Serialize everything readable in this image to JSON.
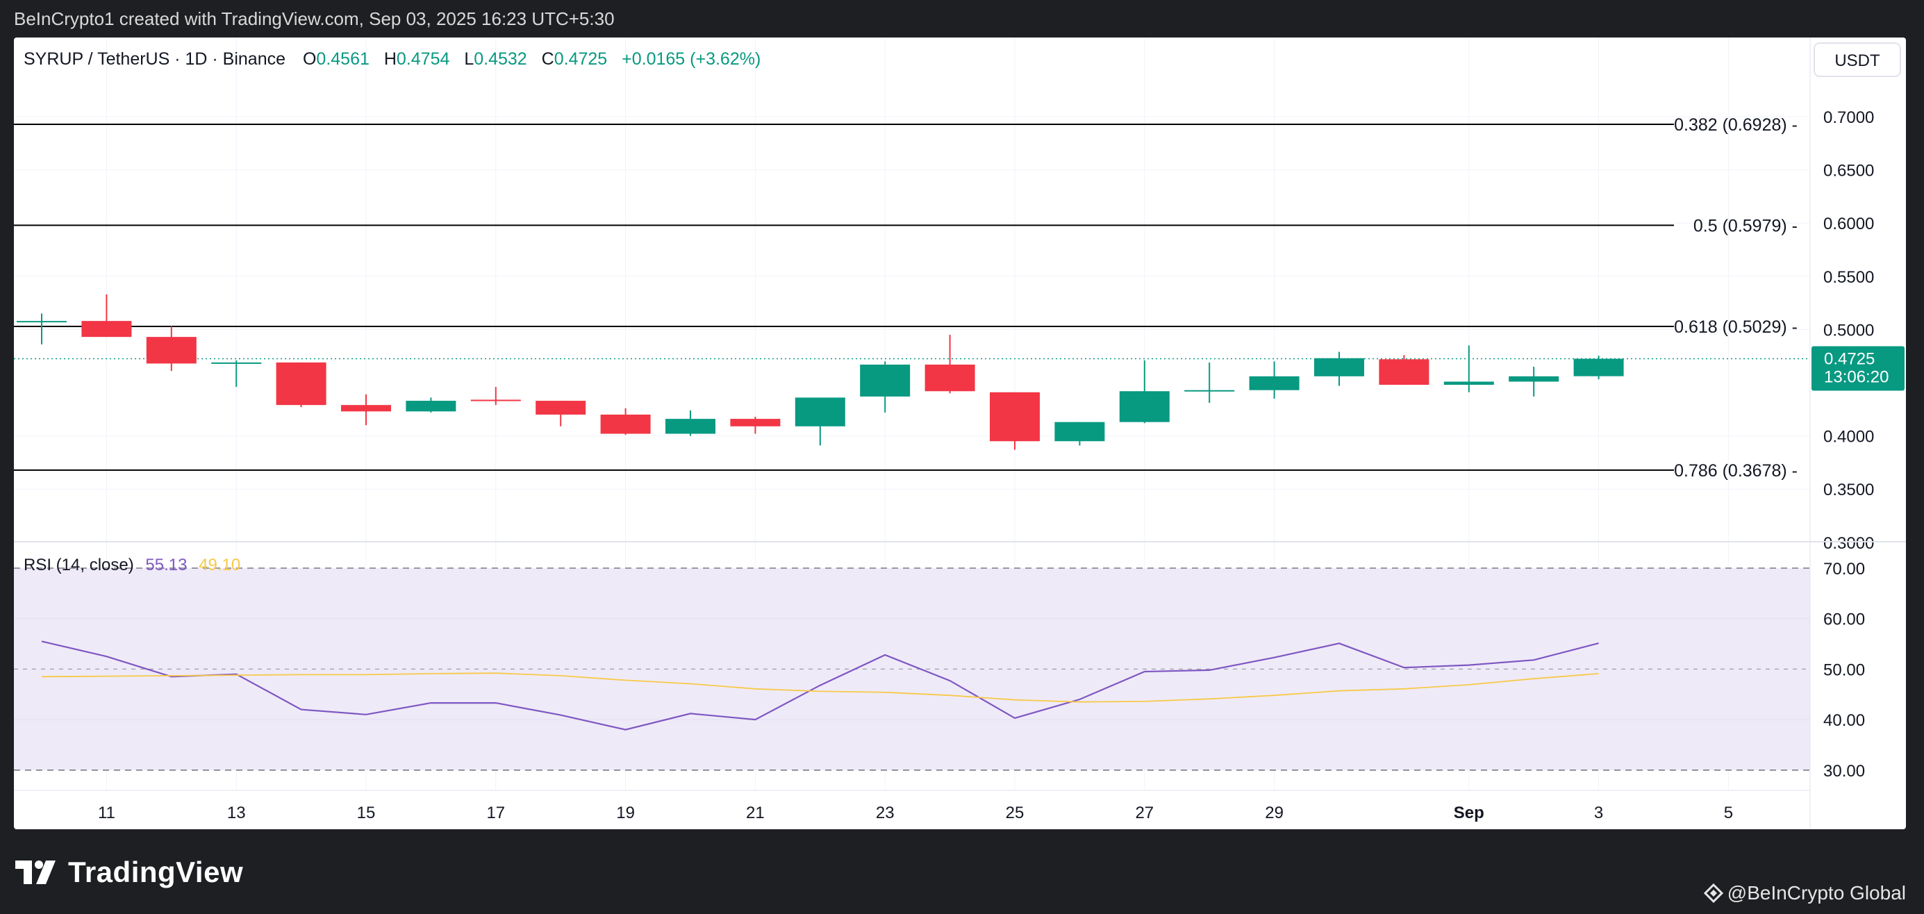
{
  "header": {
    "credit_line": "BeInCrypto1 created with TradingView.com, Sep 03, 2025 16:23 UTC+5:30"
  },
  "symbol_bar": {
    "pair": "SYRUP / TetherUS · 1D · Binance",
    "o_label": "O",
    "o_value": "0.4561",
    "h_label": "H",
    "h_value": "0.4754",
    "l_label": "L",
    "l_value": "0.4532",
    "c_label": "C",
    "c_value": "0.4725",
    "change": "+0.0165 (+3.62%)"
  },
  "currency_button": "USDT",
  "last_price": {
    "price": "0.4725",
    "countdown": "13:06:20"
  },
  "rsi_legend": {
    "label": "RSI (14, close)",
    "rsi_value": "55.13",
    "ma_value": "49.10"
  },
  "footer": {
    "logo_text": "TradingView",
    "credit": "@BeInCrypto Global"
  },
  "colors": {
    "up": "#089981",
    "down": "#f23645",
    "rsi_line": "#7e57c2",
    "rsi_ma": "#f7c948",
    "rsi_band_fill": "#efeaf8",
    "fib_line": "#000000"
  },
  "chart_data": [
    {
      "type": "candlestick",
      "title": "SYRUP / TetherUS · 1D · Binance",
      "y_axis_ticks": [
        "0.7000",
        "0.6500",
        "0.6000",
        "0.5500",
        "0.5000",
        "0.4000",
        "0.3500",
        "0.3000"
      ],
      "ylim": [
        0.3,
        0.72
      ],
      "x_tick_labels": [
        "11",
        "13",
        "15",
        "17",
        "19",
        "21",
        "23",
        "25",
        "27",
        "29",
        "Sep",
        "3",
        "5"
      ],
      "x_axis_span_days": [
        "2025-08-10",
        "2025-09-05"
      ],
      "candles": [
        {
          "date": "2025-08-10",
          "o": 0.507,
          "h": 0.515,
          "l": 0.486,
          "c": 0.508
        },
        {
          "date": "2025-08-11",
          "o": 0.508,
          "h": 0.533,
          "l": 0.493,
          "c": 0.493
        },
        {
          "date": "2025-08-12",
          "o": 0.493,
          "h": 0.503,
          "l": 0.461,
          "c": 0.468
        },
        {
          "date": "2025-08-13",
          "o": 0.468,
          "h": 0.471,
          "l": 0.446,
          "c": 0.469
        },
        {
          "date": "2025-08-14",
          "o": 0.469,
          "h": 0.469,
          "l": 0.427,
          "c": 0.429
        },
        {
          "date": "2025-08-15",
          "o": 0.429,
          "h": 0.439,
          "l": 0.41,
          "c": 0.423
        },
        {
          "date": "2025-08-16",
          "o": 0.423,
          "h": 0.436,
          "l": 0.422,
          "c": 0.433
        },
        {
          "date": "2025-08-17",
          "o": 0.434,
          "h": 0.446,
          "l": 0.429,
          "c": 0.433
        },
        {
          "date": "2025-08-18",
          "o": 0.433,
          "h": 0.433,
          "l": 0.409,
          "c": 0.42
        },
        {
          "date": "2025-08-19",
          "o": 0.42,
          "h": 0.426,
          "l": 0.401,
          "c": 0.402
        },
        {
          "date": "2025-08-20",
          "o": 0.402,
          "h": 0.424,
          "l": 0.4,
          "c": 0.416
        },
        {
          "date": "2025-08-21",
          "o": 0.416,
          "h": 0.418,
          "l": 0.402,
          "c": 0.409
        },
        {
          "date": "2025-08-22",
          "o": 0.409,
          "h": 0.436,
          "l": 0.391,
          "c": 0.436
        },
        {
          "date": "2025-08-23",
          "o": 0.437,
          "h": 0.47,
          "l": 0.422,
          "c": 0.467
        },
        {
          "date": "2025-08-24",
          "o": 0.467,
          "h": 0.495,
          "l": 0.44,
          "c": 0.442
        },
        {
          "date": "2025-08-25",
          "o": 0.441,
          "h": 0.441,
          "l": 0.387,
          "c": 0.395
        },
        {
          "date": "2025-08-26",
          "o": 0.395,
          "h": 0.413,
          "l": 0.391,
          "c": 0.413
        },
        {
          "date": "2025-08-27",
          "o": 0.413,
          "h": 0.471,
          "l": 0.412,
          "c": 0.442
        },
        {
          "date": "2025-08-28",
          "o": 0.442,
          "h": 0.469,
          "l": 0.431,
          "c": 0.443
        },
        {
          "date": "2025-08-29",
          "o": 0.443,
          "h": 0.47,
          "l": 0.435,
          "c": 0.456
        },
        {
          "date": "2025-08-30",
          "o": 0.456,
          "h": 0.479,
          "l": 0.447,
          "c": 0.473
        },
        {
          "date": "2025-08-31",
          "o": 0.472,
          "h": 0.476,
          "l": 0.448,
          "c": 0.448
        },
        {
          "date": "2025-09-01",
          "o": 0.448,
          "h": 0.485,
          "l": 0.441,
          "c": 0.451
        },
        {
          "date": "2025-09-02",
          "o": 0.451,
          "h": 0.465,
          "l": 0.437,
          "c": 0.456
        },
        {
          "date": "2025-09-03",
          "o": 0.4561,
          "h": 0.4754,
          "l": 0.4532,
          "c": 0.4725
        }
      ],
      "fib_levels": [
        {
          "label": "0.382 (0.6928)",
          "value": 0.6928
        },
        {
          "label": "0.5 (0.5979)",
          "value": 0.5979
        },
        {
          "label": "0.618 (0.5029)",
          "value": 0.5029
        },
        {
          "label": "0.786 (0.3678)",
          "value": 0.3678
        }
      ],
      "last_price_line": 0.4725
    },
    {
      "type": "line",
      "title": "RSI (14, close)",
      "y_axis_ticks": [
        "70.00",
        "60.00",
        "50.00",
        "40.00",
        "30.00"
      ],
      "ylim": [
        28,
        71
      ],
      "band": [
        30,
        70
      ],
      "dashed_levels": [
        70,
        50,
        30
      ],
      "series": [
        {
          "name": "RSI",
          "color": "#7e57c2",
          "values": [
            55.5,
            52.5,
            48.5,
            49.0,
            42.0,
            41.0,
            43.3,
            43.3,
            40.9,
            38.0,
            41.2,
            40.0,
            46.8,
            52.8,
            47.7,
            40.3,
            44.0,
            49.5,
            49.8,
            52.3,
            55.1,
            50.3,
            50.8,
            51.8,
            55.13
          ]
        },
        {
          "name": "RSI-based MA",
          "color": "#f7c948",
          "values": [
            48.5,
            48.6,
            48.7,
            48.8,
            48.9,
            48.9,
            49.1,
            49.2,
            48.7,
            47.8,
            47.1,
            46.1,
            45.6,
            45.4,
            44.8,
            43.9,
            43.5,
            43.6,
            44.1,
            44.8,
            45.7,
            46.1,
            46.9,
            48.1,
            49.1
          ]
        }
      ]
    }
  ]
}
